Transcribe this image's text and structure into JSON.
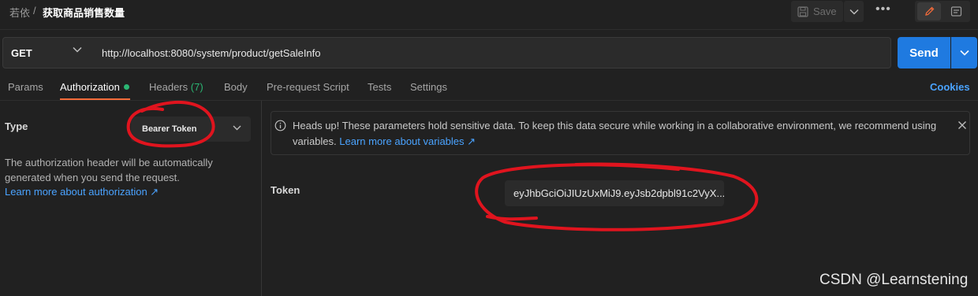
{
  "header": {
    "breadcrumb_parent": "若依",
    "breadcrumb_separator": "/",
    "request_name": "获取商品销售数量",
    "save_label": "Save",
    "more_label": "•••"
  },
  "request": {
    "method": "GET",
    "url": "http://localhost:8080/system/product/getSaleInfo",
    "send_label": "Send"
  },
  "tabs": [
    {
      "label": "Params"
    },
    {
      "label": "Authorization"
    },
    {
      "label": "Headers",
      "count": "(7)"
    },
    {
      "label": "Body"
    },
    {
      "label": "Pre-request Script"
    },
    {
      "label": "Tests"
    },
    {
      "label": "Settings"
    }
  ],
  "cookies_label": "Cookies",
  "auth": {
    "type_label": "Type",
    "type_value": "Bearer Token",
    "help_text": "The authorization header will be automatically generated when you send the request.",
    "help_link": "Learn more about authorization ↗"
  },
  "notice": {
    "text": "Heads up! These parameters hold sensitive data. To keep this data secure while working in a collaborative environment, we recommend using variables.",
    "link": "Learn more about variables ↗"
  },
  "token": {
    "label": "Token",
    "value": "eyJhbGciOiJIUzUxMiJ9.eyJsb2dpbl91c2VyX..."
  },
  "watermark": "CSDN @Learnstening",
  "colors": {
    "accent": "#f26b3a",
    "send": "#1f7ae0",
    "link": "#4aa3ff",
    "success": "#2bb673",
    "annotation": "#e0141e"
  }
}
